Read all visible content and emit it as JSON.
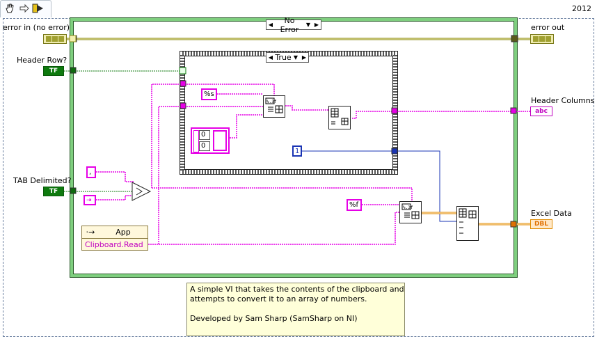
{
  "version": "2012",
  "toolbar": {
    "icons": [
      "pointer-hand-icon",
      "step-arrow-icon",
      "run-arrow-icon"
    ]
  },
  "outer_case": {
    "selector_value": "No Error"
  },
  "inner_case": {
    "selector_value": "True"
  },
  "controls": {
    "error_in": "error in (no error)",
    "header_row": "Header Row?",
    "tab_delimited": "TAB Delimited?"
  },
  "indicators": {
    "error_out": "error out",
    "header_columns": "Header Columns",
    "excel_data": "Excel Data"
  },
  "terminals": {
    "bool": "TF",
    "string": "abc",
    "dbl": "DBL"
  },
  "constants": {
    "format_s": "%s",
    "format_f": "%f",
    "numeric_one": "1",
    "array_index_0": "0",
    "array_index_1": "0",
    "comma": ","
  },
  "property_node": {
    "class": "App",
    "property": "Clipboard.Read"
  },
  "comment": {
    "line1": "A simple VI that takes the contents of the clipboard and",
    "line2": "attempts to convert it to an array of numbers.",
    "line3": "",
    "line4": "Developed by Sam Sharp (SamSharp on NI)"
  },
  "colors": {
    "error_wire": "#8a8a1a",
    "bool_wire": "#0e7a0e",
    "string_wire": "#e600e6",
    "numeric_wire": "#1a34b4",
    "dbl_wire": "#e08a00",
    "case_green": "#7fcf7f"
  }
}
